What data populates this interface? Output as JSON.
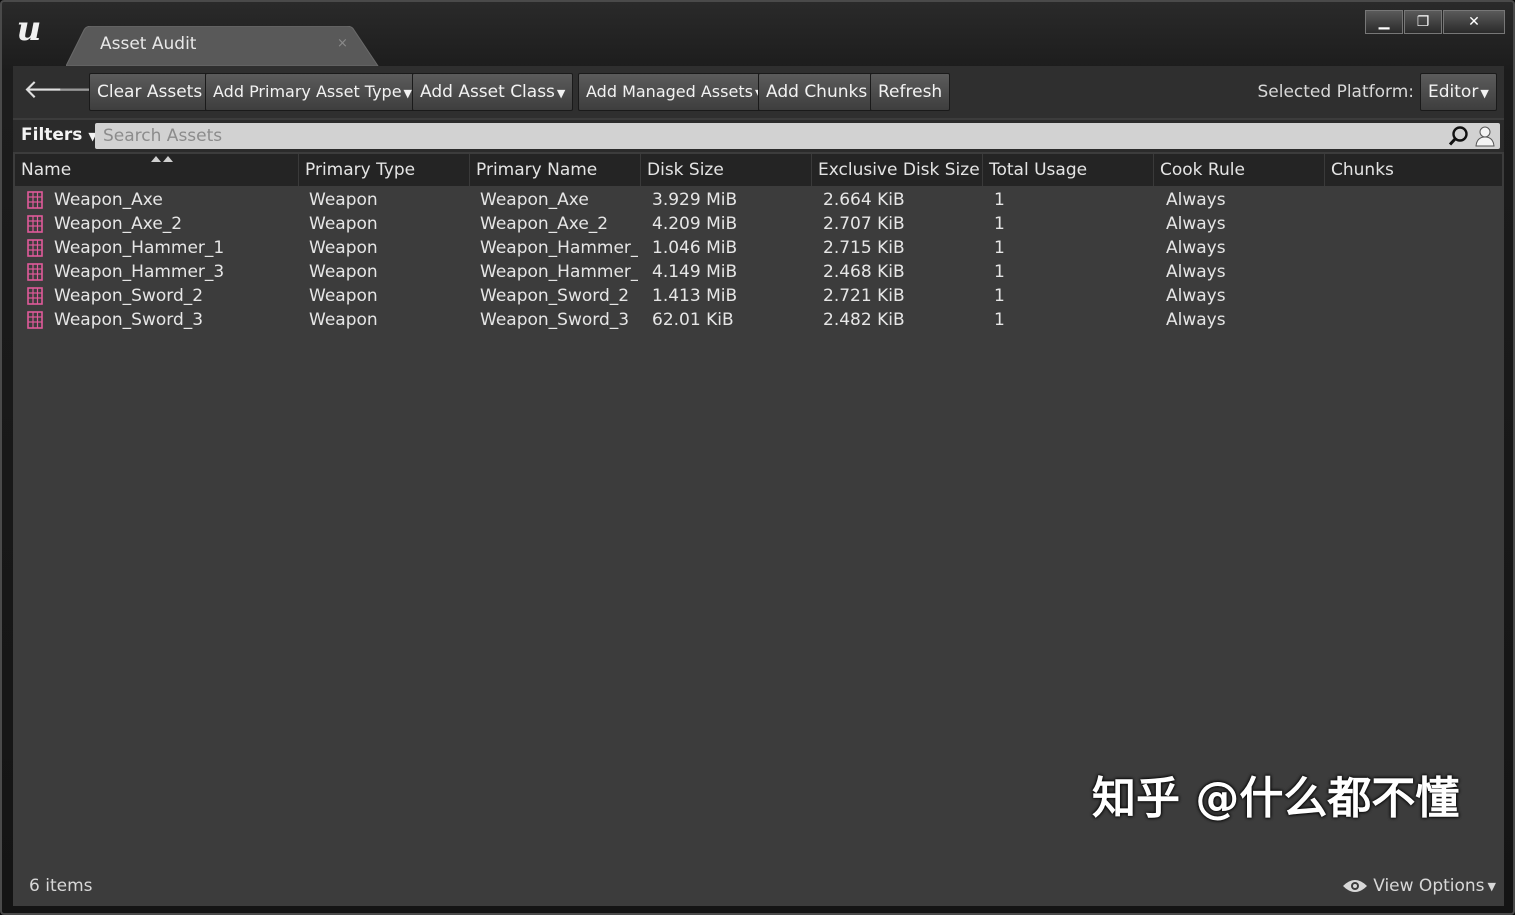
{
  "window": {
    "logo": "u",
    "tab_title": "Asset Audit",
    "tab_close": "×",
    "controls": {
      "minimize": "▁",
      "maximize": "❐",
      "close": "✕"
    }
  },
  "toolbar": {
    "back": "🡐",
    "forward": "🡒",
    "clear_assets": "Clear Assets",
    "add_primary_asset_type": "Add Primary Asset Type",
    "add_asset_class": "Add Asset Class",
    "add_managed_assets": "Add Managed Assets",
    "add_chunks": "Add Chunks",
    "refresh": "Refresh",
    "platform_label": "Selected Platform:",
    "platform_value": "Editor",
    "caret": "▼"
  },
  "filterbar": {
    "filters_label": "Filters",
    "search_placeholder": "Search Assets"
  },
  "columns": [
    "Name",
    "Primary Type",
    "Primary Name",
    "Disk Size",
    "Exclusive Disk Size",
    "Total Usage",
    "Cook Rule",
    "Chunks"
  ],
  "rows": [
    {
      "name": "Weapon_Axe",
      "primary_type": "Weapon",
      "primary_name": "Weapon_Axe",
      "disk_size": "3.929 MiB",
      "exclusive_disk_size": "2.664 KiB",
      "total_usage": "1",
      "cook_rule": "Always"
    },
    {
      "name": "Weapon_Axe_2",
      "primary_type": "Weapon",
      "primary_name": "Weapon_Axe_2",
      "disk_size": "4.209 MiB",
      "exclusive_disk_size": "2.707 KiB",
      "total_usage": "1",
      "cook_rule": "Always"
    },
    {
      "name": "Weapon_Hammer_1",
      "primary_type": "Weapon",
      "primary_name": "Weapon_Hammer_1",
      "disk_size": "1.046 MiB",
      "exclusive_disk_size": "2.715 KiB",
      "total_usage": "1",
      "cook_rule": "Always"
    },
    {
      "name": "Weapon_Hammer_3",
      "primary_type": "Weapon",
      "primary_name": "Weapon_Hammer_3",
      "disk_size": "4.149 MiB",
      "exclusive_disk_size": "2.468 KiB",
      "total_usage": "1",
      "cook_rule": "Always"
    },
    {
      "name": "Weapon_Sword_2",
      "primary_type": "Weapon",
      "primary_name": "Weapon_Sword_2",
      "disk_size": "1.413 MiB",
      "exclusive_disk_size": "2.721 KiB",
      "total_usage": "1",
      "cook_rule": "Always"
    },
    {
      "name": "Weapon_Sword_3",
      "primary_type": "Weapon",
      "primary_name": "Weapon_Sword_3",
      "disk_size": "62.01 KiB",
      "exclusive_disk_size": "2.482 KiB",
      "total_usage": "1",
      "cook_rule": "Always"
    }
  ],
  "footer": {
    "item_count": "6 items",
    "view_options": "View Options"
  },
  "watermark": "知乎 @什么都不懂",
  "icons": {
    "asset": "data-asset-icon",
    "search": "search-icon",
    "person": "person-icon",
    "eye": "eye-icon"
  },
  "colors": {
    "panel_bg": "#3c3c3c",
    "header_bg": "#242424",
    "asset_icon": "#e05a9a"
  }
}
